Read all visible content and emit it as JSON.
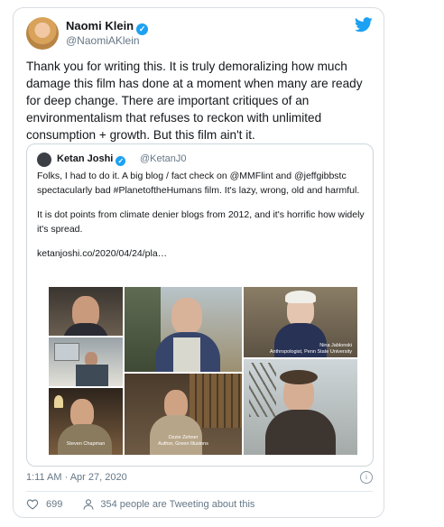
{
  "tweet": {
    "author_name": "Naomi Klein",
    "author_handle": "@NaomiAKlein",
    "text": "Thank you for writing this. It is truly demoralizing how much damage this film has done at a moment when many are ready for deep change. There are important critiques of an environmentalism that refuses to reckon with unlimited consumption + growth. But this film ain't it.",
    "timestamp": "1:11 AM · Apr 27, 2020",
    "likes": "699",
    "tweeting_about": "354 people are Tweeting about this"
  },
  "quoted": {
    "author_name": "Ketan Joshi",
    "author_handle": "@KetanJ0",
    "paragraph1": "Folks, I had to do it. A big blog / fact check on @MMFlint and @jeffgibbstc spectacularly bad #PlanetoftheHumans film. It's lazy, wrong, old and harmful.",
    "paragraph2": "It is dot points from climate denier blogs from 2012, and it's horrific how widely it's spread.",
    "link": "ketanjoshi.co/2020/04/24/pla…",
    "captions": {
      "nina": "Nina Jablonski\nAnthropologist, Penn State University",
      "steven": "Steven Chapman",
      "ozzie": "Ozzie Zehner\nAuthor, Green Illusions"
    }
  },
  "colors": {
    "twitter_blue": "#1da1f2",
    "muted": "#657786"
  }
}
